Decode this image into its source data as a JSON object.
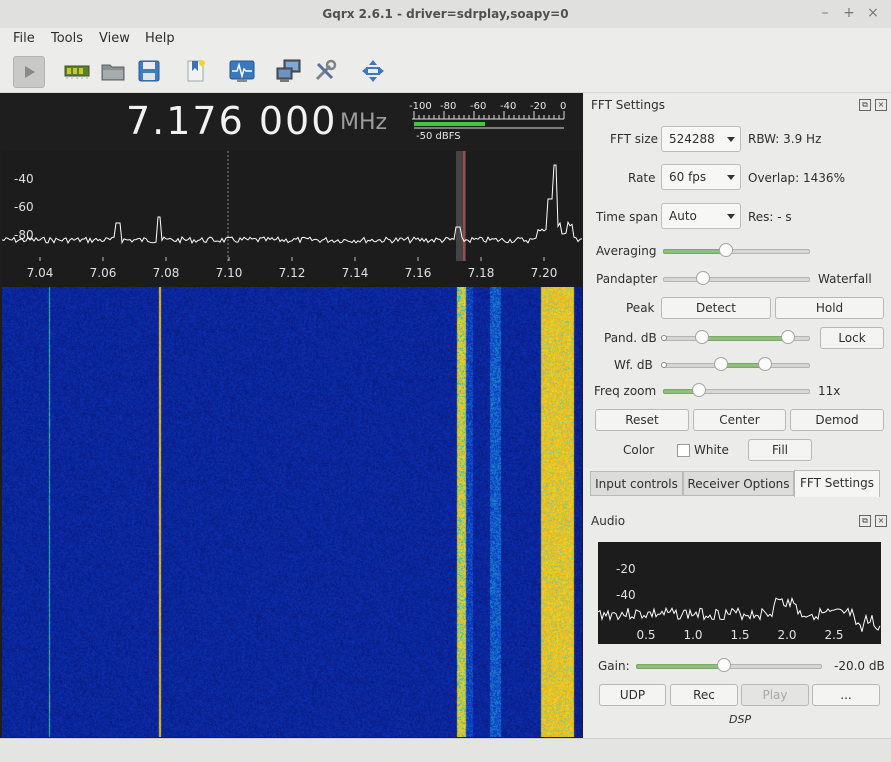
{
  "window": {
    "title": "Gqrx 2.6.1 - driver=sdrplay,soapy=0",
    "minimize_glyph": "–",
    "maximize_glyph": "+",
    "close_glyph": "×"
  },
  "menu": {
    "items": [
      "File",
      "Tools",
      "View",
      "Help"
    ]
  },
  "toolbar": {
    "icons": [
      "play-icon",
      "hardware-icon",
      "open-icon",
      "save-icon",
      "bookmark-icon",
      "remote-control-icon",
      "network-icon",
      "settings-icon",
      "center-icon"
    ]
  },
  "frequency": {
    "value": "7.176 000",
    "unit": "MHz"
  },
  "signal_meter": {
    "ticks": [
      "-100",
      "-80",
      "-60",
      "-40",
      "-20",
      "0"
    ],
    "reading": "-50 dBFS",
    "level_fraction": 0.47
  },
  "pandapter": {
    "y_ticks": [
      "-40",
      "-60",
      "-80"
    ],
    "x_ticks": [
      "7.04",
      "7.06",
      "7.08",
      "7.10",
      "7.12",
      "7.14",
      "7.16",
      "7.18",
      "7.20"
    ]
  },
  "fft_settings": {
    "title": "FFT Settings",
    "fft_size_label": "FFT size",
    "fft_size_value": "524288",
    "rbw": "RBW: 3.9 Hz",
    "rate_label": "Rate",
    "rate_value": "60 fps",
    "overlap": "Overlap: 1436%",
    "time_span_label": "Time span",
    "time_span_value": "Auto",
    "res": "Res: - s",
    "averaging_label": "Averaging",
    "averaging_level": 0.42,
    "pandapter_label": "Pandapter",
    "waterfall_label": "Waterfall",
    "pandapter_level": 0.25,
    "peak_label": "Peak",
    "detect_label": "Detect",
    "hold_label": "Hold",
    "pand_db_label": "Pand. dB",
    "lock_label": "Lock",
    "wf_db_label": "Wf. dB",
    "freq_zoom_label": "Freq zoom",
    "freq_zoom_value": "11x",
    "freq_zoom_level": 0.22,
    "reset_label": "Reset",
    "center_label": "Center",
    "demod_label": "Demod",
    "color_label": "Color",
    "white_label": "White",
    "fill_label": "Fill"
  },
  "tabs": [
    "Input controls",
    "Receiver Options",
    "FFT Settings"
  ],
  "audio": {
    "title": "Audio",
    "y_ticks": [
      "-20",
      "-40"
    ],
    "x_ticks": [
      "0.5",
      "1.0",
      "1.5",
      "2.0",
      "2.5"
    ],
    "gain_label": "Gain:",
    "gain_value": "-20.0 dB",
    "gain_level": 0.47,
    "udp_label": "UDP",
    "rec_label": "Rec",
    "play_label": "Play",
    "more_label": "...",
    "dsp_label": "DSP"
  }
}
